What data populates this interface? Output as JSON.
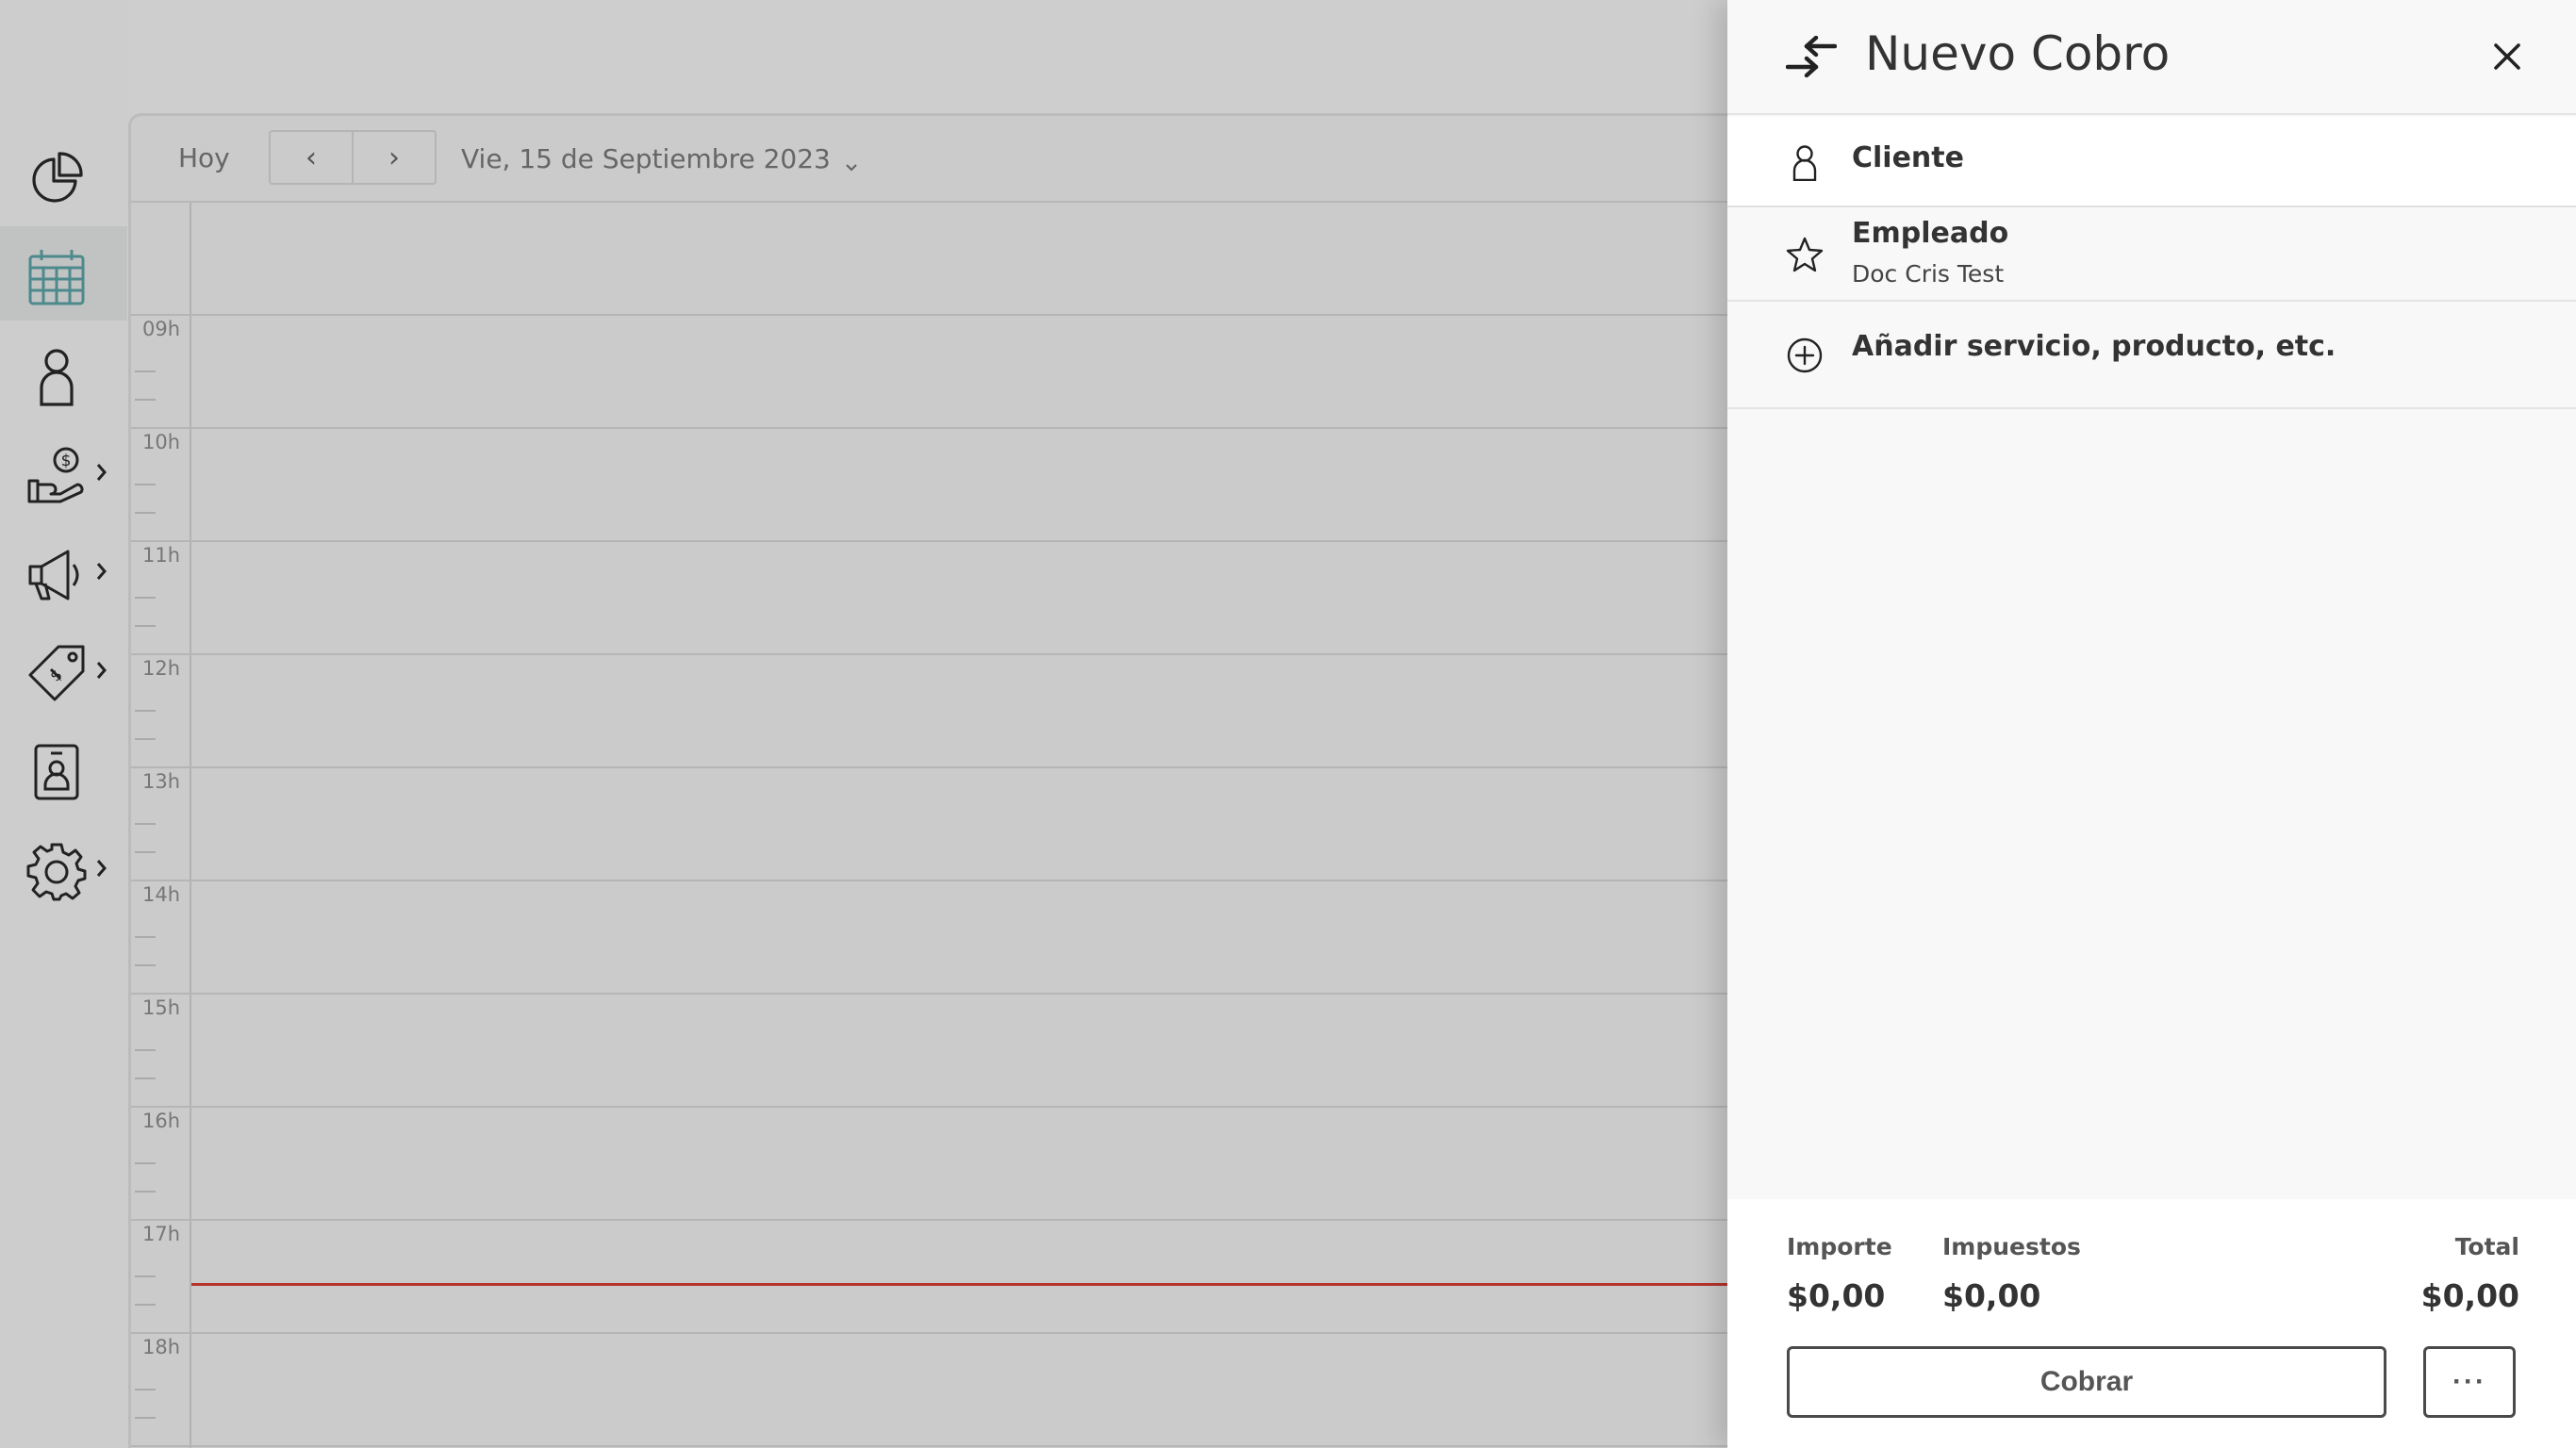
{
  "sidebar": {
    "items": [
      {
        "name": "dashboard",
        "icon": "pie-chart-icon"
      },
      {
        "name": "calendar",
        "icon": "calendar-icon",
        "active": true
      },
      {
        "name": "clients",
        "icon": "user-icon"
      },
      {
        "name": "billing",
        "icon": "hand-money-icon",
        "has_submenu": true
      },
      {
        "name": "marketing",
        "icon": "megaphone-icon",
        "has_submenu": true
      },
      {
        "name": "catalog",
        "icon": "price-tags-icon",
        "has_submenu": true
      },
      {
        "name": "staff",
        "icon": "id-badge-icon"
      },
      {
        "name": "settings",
        "icon": "gear-icon",
        "has_submenu": true
      }
    ],
    "active_color": "#4e8a8c"
  },
  "calendar": {
    "today_label": "Hoy",
    "prev_label": "‹",
    "next_label": "›",
    "date_label": "Vie, 15 de Septiembre 2023",
    "hours": [
      "09h",
      "10h",
      "11h",
      "12h",
      "13h",
      "14h",
      "15h",
      "16h",
      "17h",
      "18h"
    ],
    "current_time_line_color": "#b5352c"
  },
  "panel": {
    "title": "Nuevo Cobro",
    "header_icon": "swap-arrows-icon",
    "close_icon": "close-icon",
    "client": {
      "label": "Cliente",
      "icon": "user-icon"
    },
    "employee": {
      "label": "Empleado",
      "value": "Doc Cris Test",
      "icon": "star-icon"
    },
    "add_item": {
      "label": "Añadir servicio, producto, etc.",
      "icon": "plus-circle-icon"
    },
    "totals": {
      "importe_label": "Importe",
      "importe_value": "$0,00",
      "impuestos_label": "Impuestos",
      "impuestos_value": "$0,00",
      "total_label": "Total",
      "total_value": "$0,00"
    },
    "charge_button": "Cobrar",
    "more_button": "···"
  }
}
